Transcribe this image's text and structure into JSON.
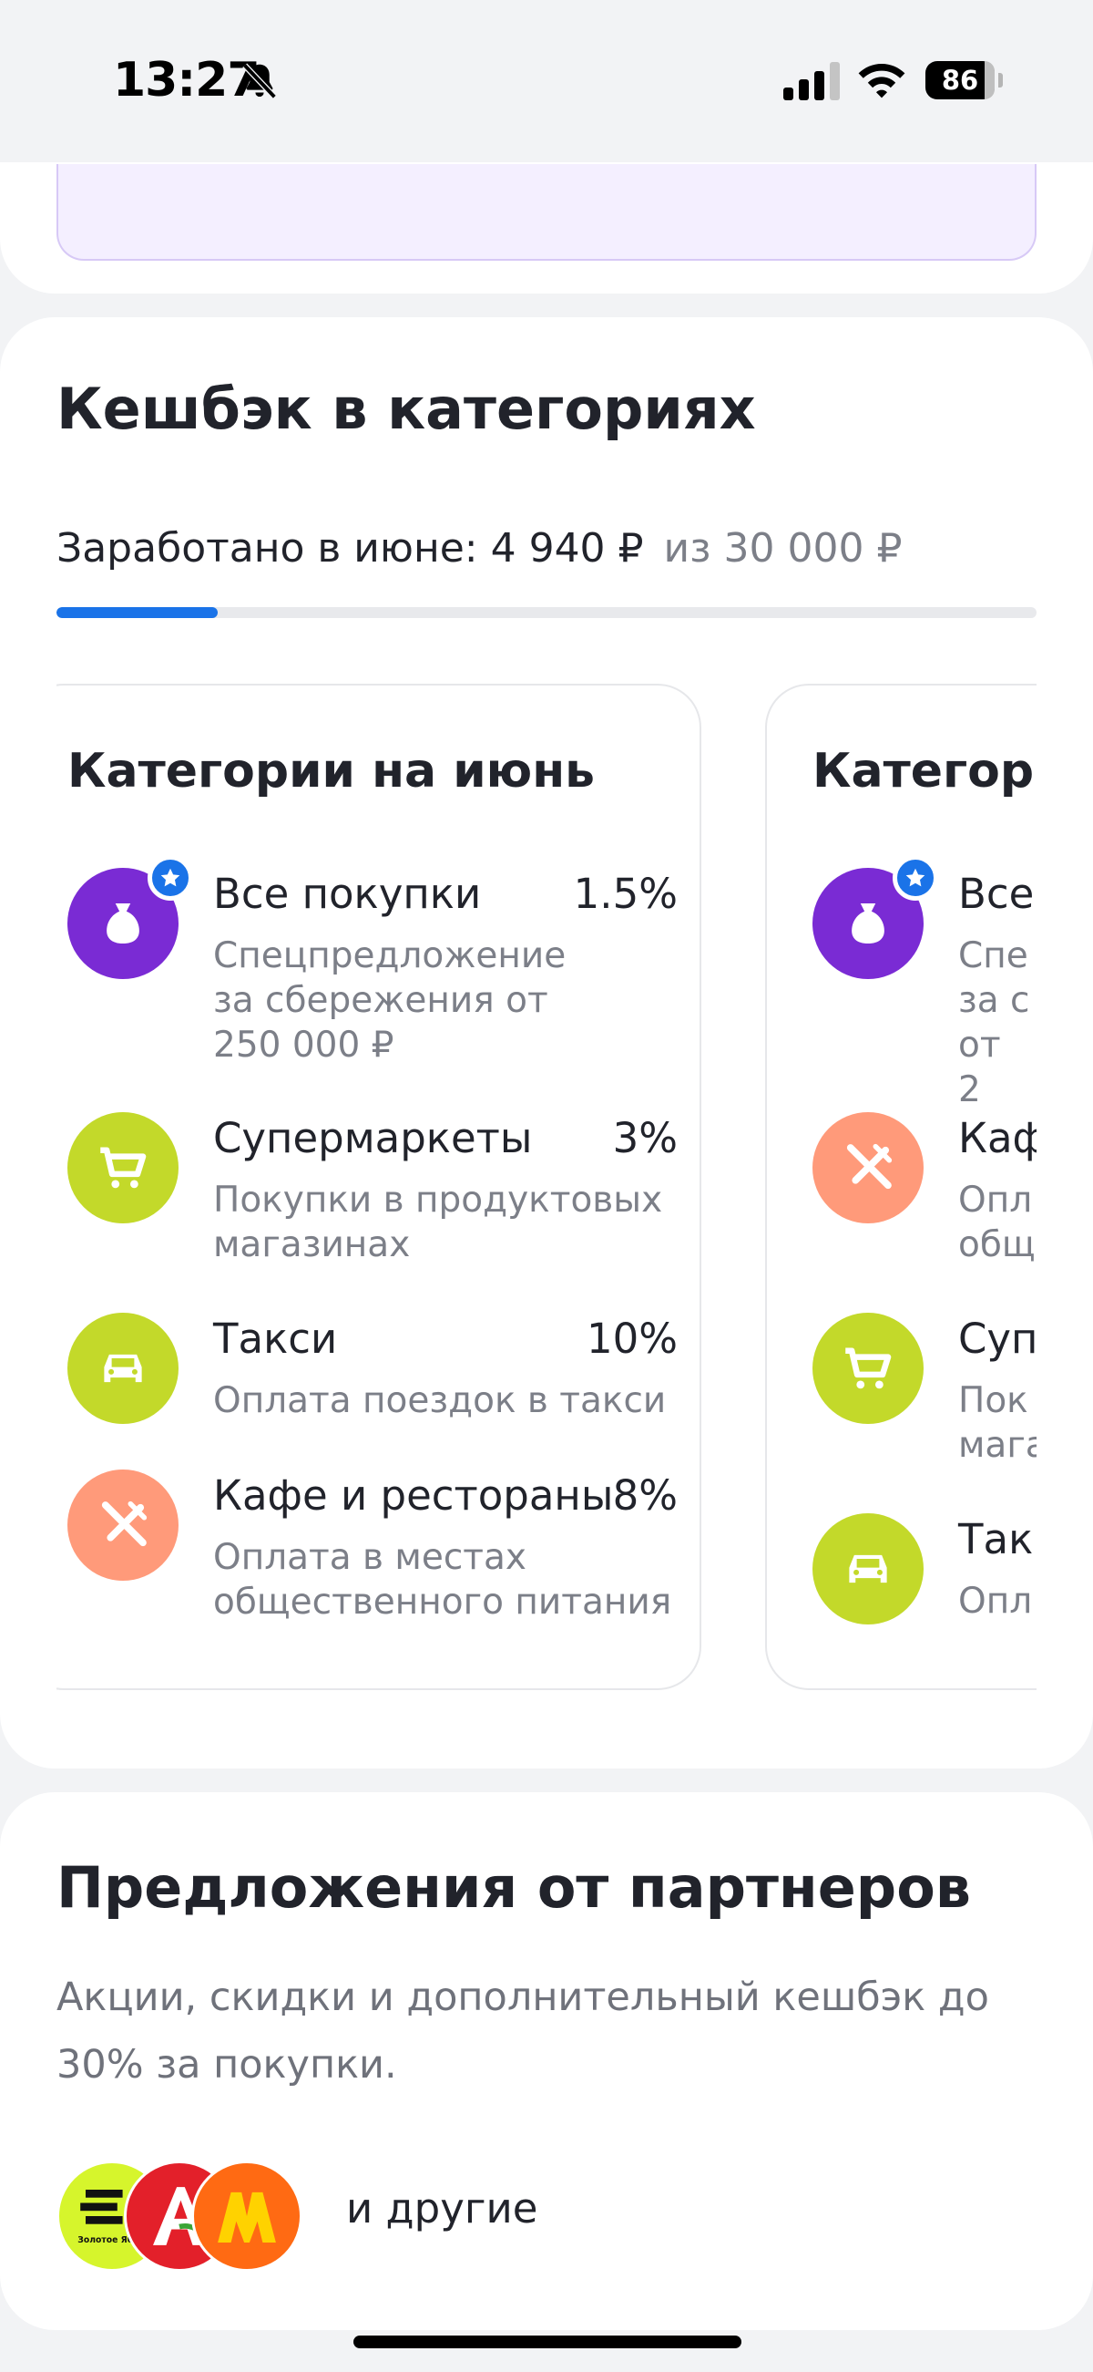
{
  "status_bar": {
    "time": "13:27",
    "battery": "86",
    "icons": [
      "bell-off-icon",
      "signal-icon",
      "wifi-icon",
      "battery-icon"
    ]
  },
  "cashback": {
    "title": "Кешбэк в категориях",
    "earned_label": "Заработано в июне: 4 940 ₽",
    "limit_label": "из 30 000 ₽",
    "progress_fraction": 0.1647,
    "cards": [
      {
        "title": "Категории на июнь",
        "items": [
          {
            "icon": "piggy-bag-icon",
            "color": "#7a2bd4",
            "badge": "star-icon",
            "name": "Все покупки",
            "percent": "1.5%",
            "desc": "Спецпредложение за сбережения от 250 000 ₽"
          },
          {
            "icon": "cart-icon",
            "color": "#c3d92a",
            "name": "Супермаркеты",
            "percent": "3%",
            "desc": "Покупки в продуктовых магазинах"
          },
          {
            "icon": "car-icon",
            "color": "#c3d92a",
            "name": "Такси",
            "percent": "10%",
            "desc": "Оплата поездок в такси"
          },
          {
            "icon": "fork-knife-icon",
            "color": "#ff9a7a",
            "name": "Кафе и рестораны",
            "percent": "8%",
            "desc": "Оплата в местах общественного питания"
          }
        ]
      },
      {
        "title": "Категори",
        "items": [
          {
            "icon": "piggy-bag-icon",
            "color": "#7a2bd4",
            "badge": "star-icon",
            "name": "Все",
            "desc": "Спе за с от 2"
          },
          {
            "icon": "fork-knife-icon",
            "color": "#ff9a7a",
            "name": "Каф",
            "desc": "Опл общ"
          },
          {
            "icon": "cart-icon",
            "color": "#c3d92a",
            "name": "Суп",
            "desc": "Пок мага"
          },
          {
            "icon": "car-icon",
            "color": "#c3d92a",
            "name": "Так",
            "desc": "Опл"
          }
        ]
      }
    ]
  },
  "partners": {
    "title": "Предложения от партнеров",
    "subtitle": "Акции, скидки и дополнительный кешбэк до 30% за покупки.",
    "logos": [
      "zolotoe-yabloko-logo",
      "auchan-logo",
      "megamarket-logo"
    ],
    "logo_text_1": "Золотое Яб",
    "and_others": "и другие"
  }
}
